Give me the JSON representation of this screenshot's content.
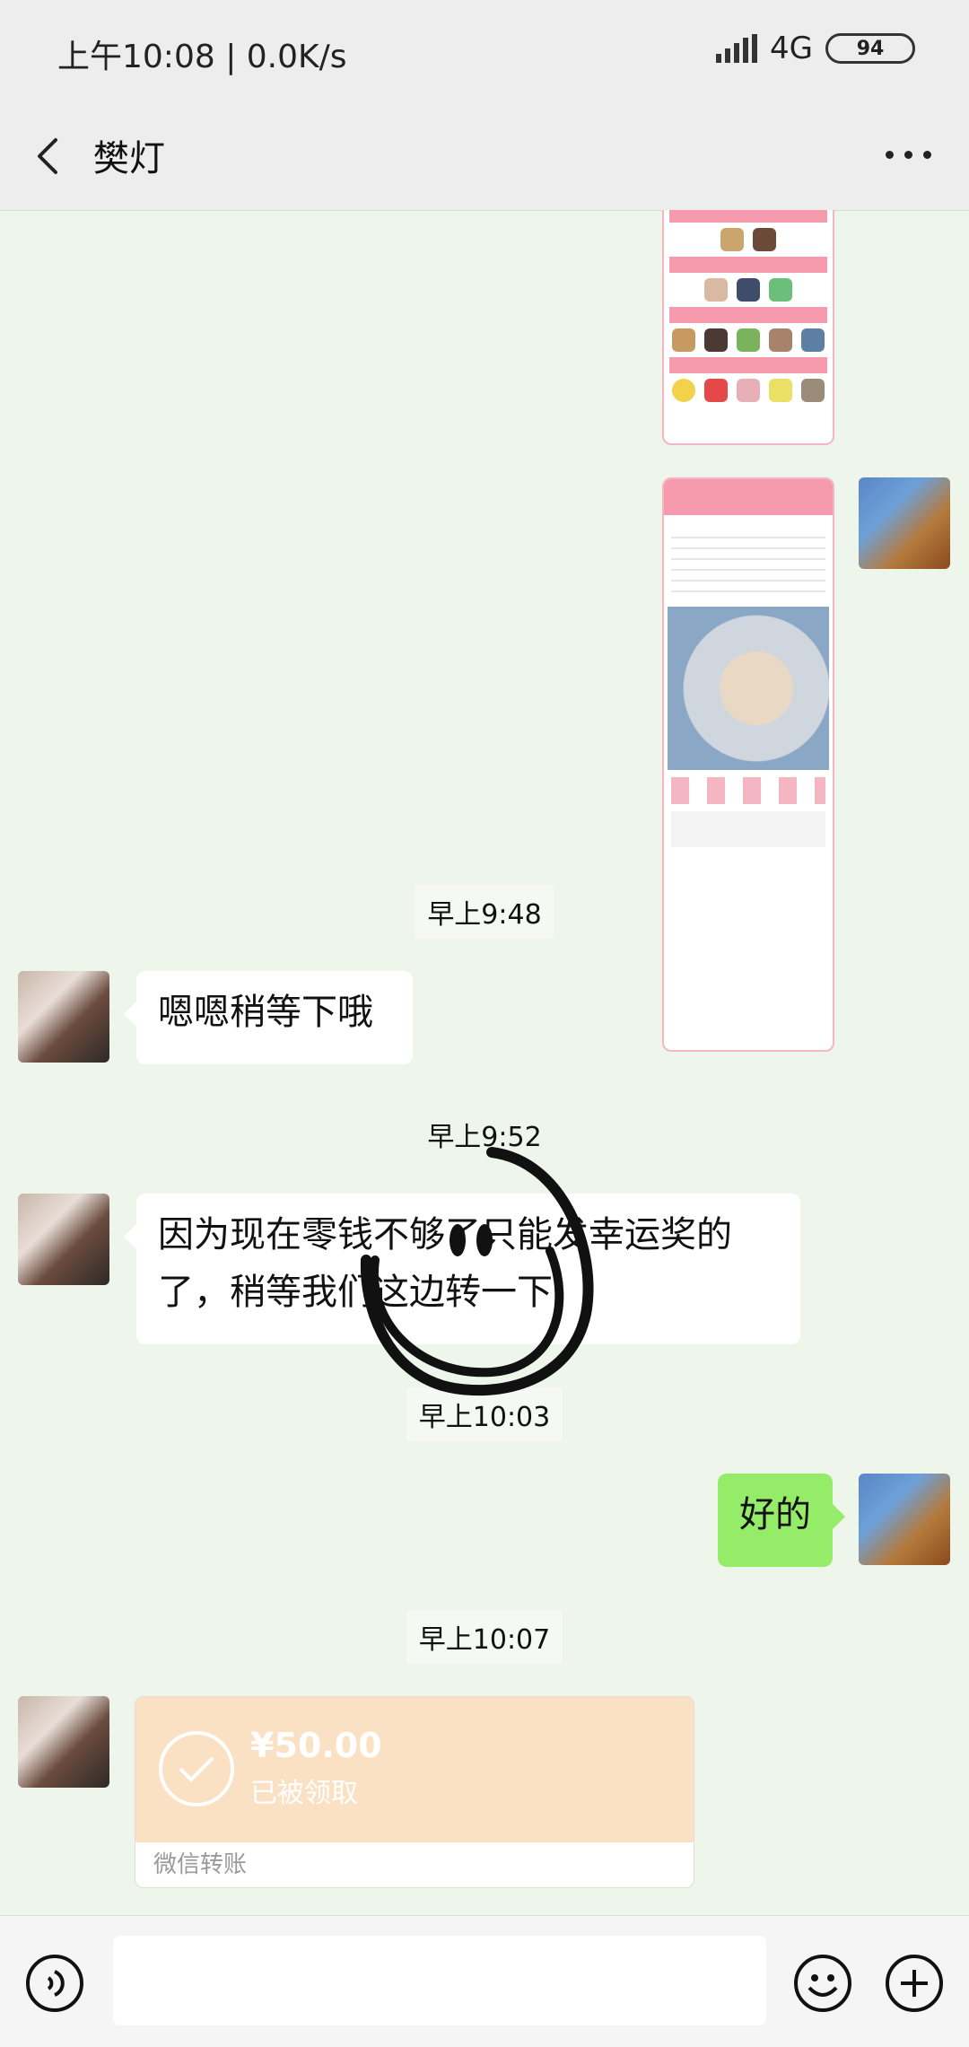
{
  "status_bar": {
    "time": "上午10:08",
    "speed": "0.0K/s",
    "network": "4G",
    "battery": "94"
  },
  "header": {
    "title": "樊灯"
  },
  "messages": {
    "time_1": "早上9:48",
    "msg_1": "嗯嗯稍等下哦",
    "time_2": "早上9:52",
    "msg_2": "因为现在零钱不够了只能发幸运奖的了，稍等我们这边转一下",
    "time_3": "早上10:03",
    "msg_3": "好的",
    "time_4": "早上10:07"
  },
  "transfer": {
    "amount": "¥50.00",
    "status": "已被领取",
    "footer": "微信转账"
  },
  "icons": [
    "back-icon",
    "more-icon",
    "voice-icon",
    "emoji-icon",
    "plus-icon",
    "check-icon"
  ]
}
